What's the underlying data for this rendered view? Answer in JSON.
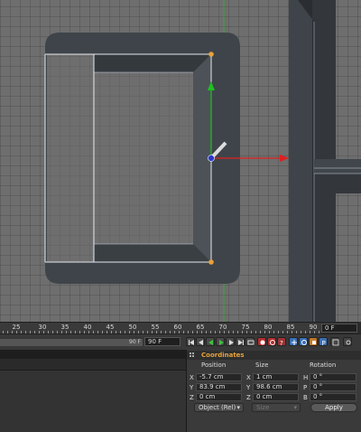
{
  "timeline": {
    "ticks": [
      "25",
      "30",
      "35",
      "40",
      "45",
      "50",
      "55",
      "60",
      "65",
      "70",
      "75",
      "80",
      "85",
      "90"
    ],
    "current_frame": "0 F",
    "range_start": "90 F",
    "range_end": "90 F"
  },
  "transport": {
    "buttons": [
      "go-to-start-icon",
      "step-back-icon",
      "play-backward-icon",
      "play-forward-icon",
      "step-forward-icon",
      "go-to-end-icon",
      "record-icon",
      "autokey-icon",
      "keyframe-selection-icon",
      "move-key-icon",
      "rotate-key-icon",
      "scale-key-icon",
      "param-key-icon",
      "pla-key-icon",
      "settings-icon"
    ]
  },
  "coordinates": {
    "title": "Coordinates",
    "columns": {
      "position": "Position",
      "size": "Size",
      "rotation": "Rotation"
    },
    "rows": [
      {
        "axis": "X",
        "position": "-5.7 cm",
        "size_axis": "X",
        "size": "1 cm",
        "rot_axis": "H",
        "rotation": "0 °"
      },
      {
        "axis": "Y",
        "position": "83.9 cm",
        "size_axis": "Y",
        "size": "98.6 cm",
        "rot_axis": "P",
        "rotation": "0 °"
      },
      {
        "axis": "Z",
        "position": "0 cm",
        "size_axis": "Z",
        "size": "0 cm",
        "rot_axis": "B",
        "rotation": "0 °"
      }
    ],
    "mode_select": "Object (Rel)",
    "size_select": "Size",
    "apply_label": "Apply"
  },
  "colors": {
    "viewport_bg": "#6e6e6e",
    "mesh_dark": "#3f444a",
    "accent_orange": "#e8a23a",
    "axis_green": "#1fc01f",
    "axis_red": "#e02020",
    "axis_blue": "#2a3ad0"
  }
}
